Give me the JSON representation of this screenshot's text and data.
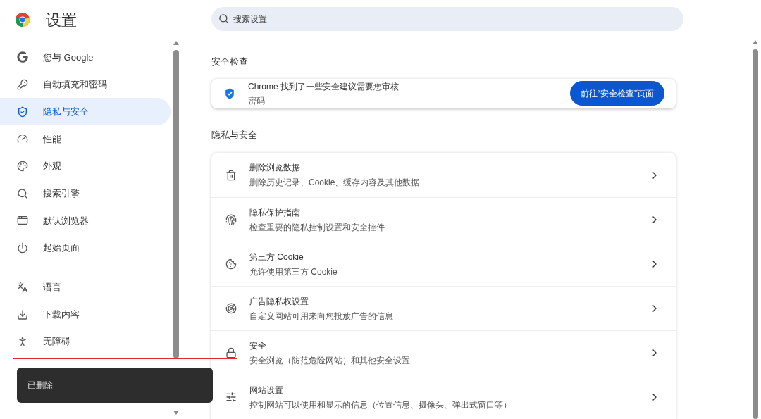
{
  "header": {
    "title": "设置"
  },
  "search": {
    "placeholder": "搜索设置"
  },
  "sidebar": {
    "groups": [
      [
        {
          "label": "您与 Google",
          "selected": false
        },
        {
          "label": "自动填充和密码",
          "selected": false
        },
        {
          "label": "隐私与安全",
          "selected": true
        },
        {
          "label": "性能",
          "selected": false
        },
        {
          "label": "外观",
          "selected": false
        },
        {
          "label": "搜索引擎",
          "selected": false
        },
        {
          "label": "默认浏览器",
          "selected": false
        },
        {
          "label": "起始页面",
          "selected": false
        }
      ],
      [
        {
          "label": "语言",
          "selected": false
        },
        {
          "label": "下载内容",
          "selected": false
        },
        {
          "label": "无障碍",
          "selected": false
        }
      ]
    ]
  },
  "safety_check": {
    "heading": "安全检查",
    "title": "Chrome 找到了一些安全建议需要您审核",
    "subtitle": "密码",
    "button": "前往“安全检查”页面"
  },
  "privacy": {
    "heading": "隐私与安全",
    "rows": [
      {
        "title": "删除浏览数据",
        "subtitle": "删除历史记录、Cookie、缓存内容及其他数据"
      },
      {
        "title": "隐私保护指南",
        "subtitle": "检查重要的隐私控制设置和安全控件"
      },
      {
        "title": "第三方 Cookie",
        "subtitle": "允许使用第三方 Cookie"
      },
      {
        "title": "广告隐私权设置",
        "subtitle": "自定义网站可用来向您投放广告的信息"
      },
      {
        "title": "安全",
        "subtitle": "安全浏览（防范危险网站）和其他安全设置"
      },
      {
        "title": "网站设置",
        "subtitle": "控制网站可以使用和显示的信息（位置信息、摄像头、弹出式窗口等）"
      }
    ]
  },
  "toast": {
    "message": "已删除"
  }
}
